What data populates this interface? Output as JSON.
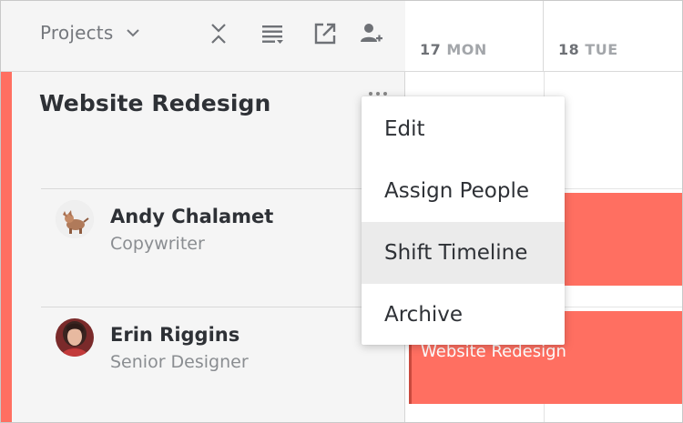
{
  "toolbar": {
    "projects_label": "Projects",
    "icons": [
      "collapse-icon",
      "list-sort-icon",
      "open-external-icon",
      "add-person-icon"
    ]
  },
  "project": {
    "title": "Website Redesign",
    "accent_color": "#ff6f61"
  },
  "people": [
    {
      "name": "Andy Chalamet",
      "role": "Copywriter"
    },
    {
      "name": "Erin Riggins",
      "role": "Senior Designer"
    }
  ],
  "timeline": {
    "days": [
      {
        "num": "17",
        "dow": "MON"
      },
      {
        "num": "18",
        "dow": "TUE"
      }
    ],
    "bars": [
      {
        "label": ""
      },
      {
        "label": "Website Redesign"
      }
    ]
  },
  "menu": {
    "items": [
      {
        "label": "Edit"
      },
      {
        "label": "Assign People"
      },
      {
        "label": "Shift Timeline"
      },
      {
        "label": "Archive"
      }
    ],
    "highlighted": "Shift Timeline"
  }
}
